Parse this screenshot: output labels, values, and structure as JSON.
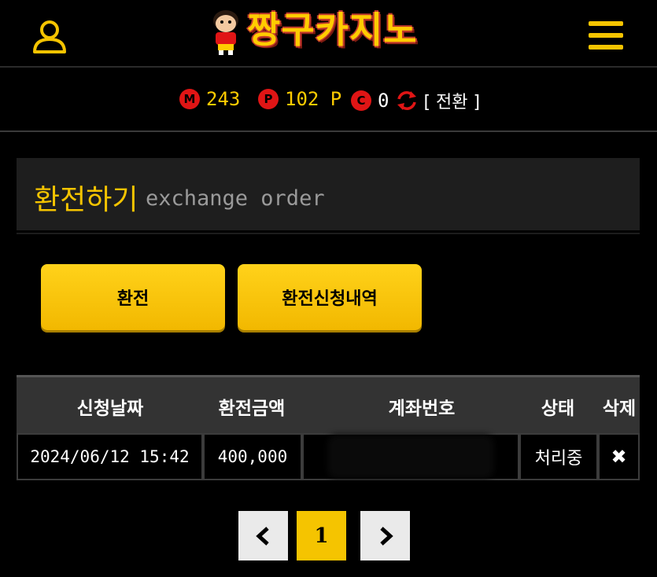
{
  "header": {
    "logo_text": "짱구카지노"
  },
  "balance": {
    "m_badge": "M",
    "m_value": "243",
    "p_badge": "P",
    "p_value": "102 P",
    "c_badge": "C",
    "c_value": "0",
    "convert_label": "[ 전환 ]"
  },
  "page": {
    "title_ko": "환전하기",
    "title_en": "exchange order"
  },
  "buttons": {
    "exchange": "환전",
    "history": "환전신청내역"
  },
  "table": {
    "headers": [
      "신청날짜",
      "환전금액",
      "계좌번호",
      "상태",
      "삭제"
    ],
    "rows": [
      {
        "date": "2024/06/12 15:42",
        "amount": "400,000",
        "account": "",
        "status": "처리중",
        "delete": "✖"
      }
    ]
  },
  "pagination": {
    "current": "1"
  },
  "colors": {
    "accent": "#f5c400",
    "badge": "#e01515",
    "panel": "#1e1e1e"
  }
}
